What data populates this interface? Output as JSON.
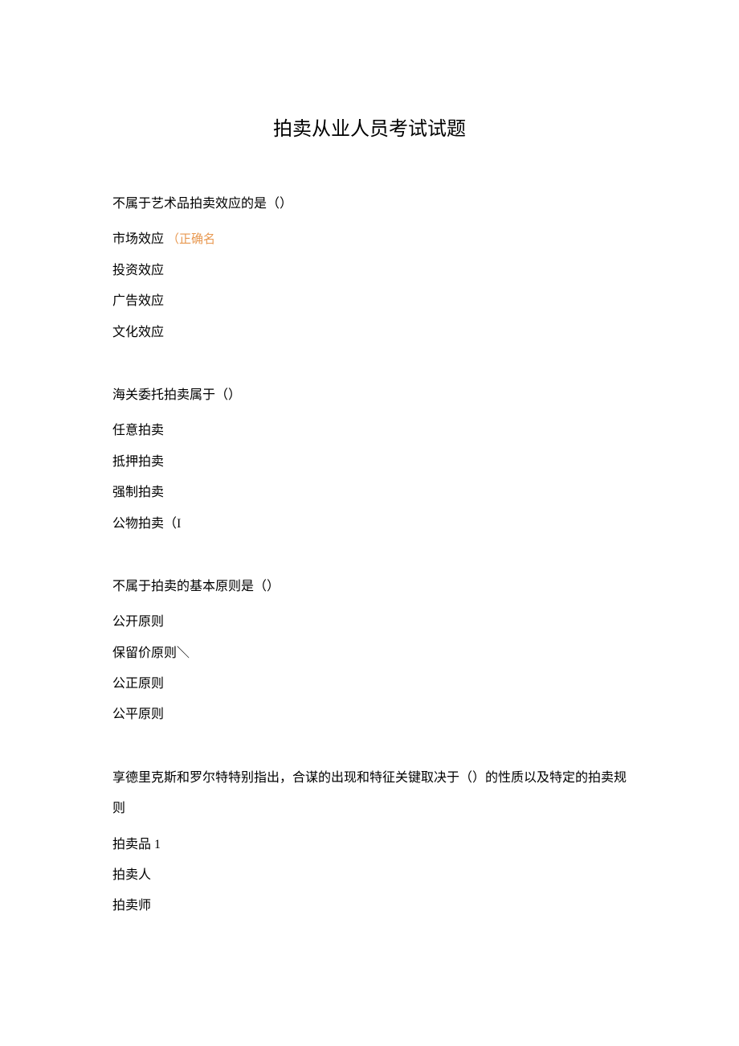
{
  "title": "拍卖从业人员考试试题",
  "questions": [
    {
      "text": "不属于艺术品拍卖效应的是（）",
      "options": [
        {
          "label": "市场效应",
          "marker": "（正确名"
        },
        {
          "label": "投资效应",
          "marker": ""
        },
        {
          "label": "广告效应",
          "marker": ""
        },
        {
          "label": "文化效应",
          "marker": ""
        }
      ]
    },
    {
      "text": "海关委托拍卖属于（）",
      "options": [
        {
          "label": "任意拍卖",
          "marker": ""
        },
        {
          "label": "抵押拍卖",
          "marker": ""
        },
        {
          "label": "强制拍卖",
          "marker": ""
        },
        {
          "label": "公物拍卖（I",
          "marker": ""
        }
      ]
    },
    {
      "text": "不属于拍卖的基本原则是（）",
      "options": [
        {
          "label": "公开原则",
          "marker": ""
        },
        {
          "label": "保留价原则＼",
          "marker": ""
        },
        {
          "label": "公正原则",
          "marker": ""
        },
        {
          "label": "公平原则",
          "marker": ""
        }
      ]
    },
    {
      "text": "享德里克斯和罗尔特特别指出，合谋的出现和特征关键取决于（）的性质以及特定的拍卖规则",
      "options": [
        {
          "label": "拍卖品 1",
          "marker": ""
        },
        {
          "label": "拍卖人",
          "marker": ""
        },
        {
          "label": "拍卖师",
          "marker": ""
        }
      ]
    }
  ]
}
